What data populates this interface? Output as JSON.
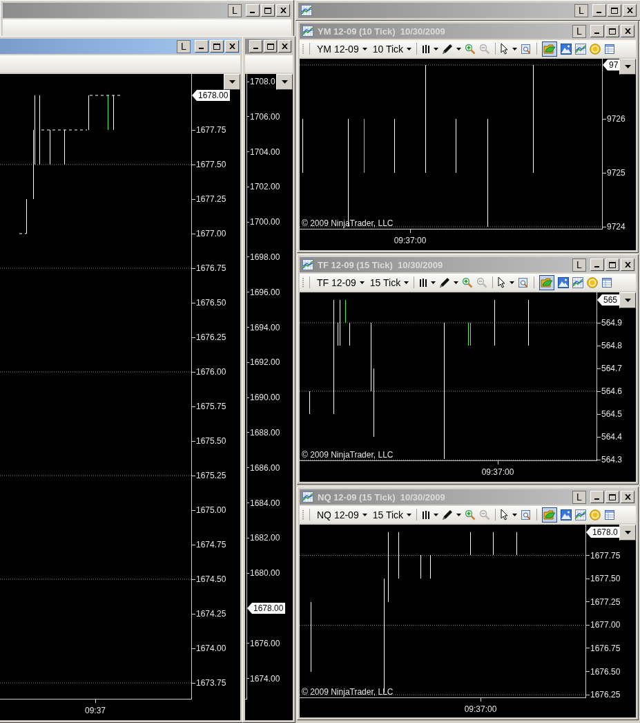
{
  "left_back_window": {
    "active": false,
    "lock": "L"
  },
  "main_chart_window": {
    "active": true,
    "lock": "L",
    "chart": {
      "y_labels": [
        {
          "text": "1678.00",
          "current": true
        },
        {
          "text": "1677.75",
          "current": false
        },
        {
          "text": "1677.50",
          "current": false
        },
        {
          "text": "1677.25",
          "current": false
        },
        {
          "text": "1677.00",
          "current": false
        },
        {
          "text": "1676.75",
          "current": false
        },
        {
          "text": "1676.50",
          "current": false
        },
        {
          "text": "1676.25",
          "current": false
        },
        {
          "text": "1676.00",
          "current": false
        },
        {
          "text": "1675.75",
          "current": false
        },
        {
          "text": "1675.50",
          "current": false
        },
        {
          "text": "1675.25",
          "current": false
        },
        {
          "text": "1675.00",
          "current": false
        },
        {
          "text": "1674.75",
          "current": false
        },
        {
          "text": "1674.50",
          "current": false
        },
        {
          "text": "1674.25",
          "current": false
        },
        {
          "text": "1674.00",
          "current": false
        },
        {
          "text": "1673.75",
          "current": false
        }
      ],
      "time_label": "09:37"
    }
  },
  "side_window": {
    "active": false,
    "chart": {
      "y_labels": [
        {
          "text": "1708.0",
          "current": false
        },
        {
          "text": "1706.00",
          "current": false
        },
        {
          "text": "1704.00",
          "current": false
        },
        {
          "text": "1702.00",
          "current": false
        },
        {
          "text": "1700.00",
          "current": false
        },
        {
          "text": "1698.00",
          "current": false
        },
        {
          "text": "1696.00",
          "current": false
        },
        {
          "text": "1694.00",
          "current": false
        },
        {
          "text": "1692.00",
          "current": false
        },
        {
          "text": "1690.00",
          "current": false
        },
        {
          "text": "1688.00",
          "current": false
        },
        {
          "text": "1686.00",
          "current": false
        },
        {
          "text": "1684.00",
          "current": false
        },
        {
          "text": "1682.00",
          "current": false
        },
        {
          "text": "1680.00",
          "current": false
        },
        {
          "text": "1678.00",
          "current": true
        },
        {
          "text": "1676.00",
          "current": false
        },
        {
          "text": "1674.00",
          "current": false
        }
      ]
    }
  },
  "right_back_window": {
    "active": false,
    "lock": "L"
  },
  "chart_windows": [
    {
      "active": false,
      "title": "YM 12-09 (10 Tick)  10/30/2009",
      "lock": "L",
      "instrument": "YM 12-09",
      "interval": "10 Tick",
      "toggle_on": true,
      "chart": {
        "y_labels": [
          {
            "text": "97",
            "current": true
          },
          {
            "text": "9726",
            "current": false
          },
          {
            "text": "9725",
            "current": false
          },
          {
            "text": "9724",
            "current": false
          }
        ],
        "copyright": "© 2009 NinjaTrader, LLC",
        "time_label": "09:37:00"
      }
    },
    {
      "active": false,
      "title": "TF 12-09 (15 Tick)  10/30/2009",
      "lock": "L",
      "instrument": "TF 12-09",
      "interval": "15 Tick",
      "toggle_on": true,
      "chart": {
        "y_labels": [
          {
            "text": "565",
            "current": true
          },
          {
            "text": "564.9",
            "current": false
          },
          {
            "text": "564.8",
            "current": false
          },
          {
            "text": "564.7",
            "current": false
          },
          {
            "text": "564.6",
            "current": false
          },
          {
            "text": "564.5",
            "current": false
          },
          {
            "text": "564.4",
            "current": false
          },
          {
            "text": "564.3",
            "current": false
          }
        ],
        "copyright": "© 2009 NinjaTrader, LLC",
        "time_label": "09:37:00"
      }
    },
    {
      "active": false,
      "title": "NQ 12-09 (15 Tick)  10/30/2009",
      "lock": "L",
      "instrument": "NQ 12-09",
      "interval": "15 Tick",
      "toggle_on": true,
      "chart": {
        "y_labels": [
          {
            "text": "1678.0",
            "current": true
          },
          {
            "text": "1677.75",
            "current": false
          },
          {
            "text": "1677.50",
            "current": false
          },
          {
            "text": "1677.25",
            "current": false
          },
          {
            "text": "1677.00",
            "current": false
          },
          {
            "text": "1676.75",
            "current": false
          },
          {
            "text": "1676.50",
            "current": false
          },
          {
            "text": "1676.25",
            "current": false
          }
        ],
        "copyright": "© 2009 NinjaTrader, LLC",
        "time_label": "09:37:00"
      }
    }
  ]
}
